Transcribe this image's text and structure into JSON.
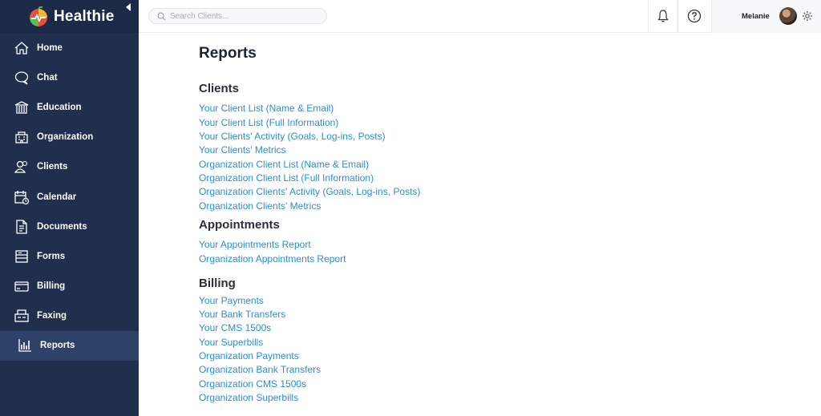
{
  "brand": {
    "name": "Healthie"
  },
  "sidebar": {
    "items": [
      {
        "label": "Home",
        "icon": "home-icon"
      },
      {
        "label": "Chat",
        "icon": "chat-icon"
      },
      {
        "label": "Education",
        "icon": "education-icon"
      },
      {
        "label": "Organization",
        "icon": "organization-icon"
      },
      {
        "label": "Clients",
        "icon": "clients-icon"
      },
      {
        "label": "Calendar",
        "icon": "calendar-icon"
      },
      {
        "label": "Documents",
        "icon": "documents-icon"
      },
      {
        "label": "Forms",
        "icon": "forms-icon"
      },
      {
        "label": "Billing",
        "icon": "billing-icon"
      },
      {
        "label": "Faxing",
        "icon": "faxing-icon"
      },
      {
        "label": "Reports",
        "icon": "reports-icon",
        "active": true
      }
    ]
  },
  "search": {
    "placeholder": "Search Clients..."
  },
  "user": {
    "name": "Melanie"
  },
  "page": {
    "title": "Reports"
  },
  "sections": {
    "clients": {
      "title": "Clients",
      "links": [
        "Your Client List (Name & Email)",
        "Your Client List (Full Information)",
        "Your Clients' Activity (Goals, Log-ins, Posts)",
        "Your Clients' Metrics",
        "Organization Client List (Name & Email)",
        "Organization Client List (Full Information)",
        "Organization Clients' Activity (Goals, Log-ins, Posts)",
        "Organization Clients' Metrics"
      ]
    },
    "appointments": {
      "title": "Appointments",
      "links": [
        "Your Appointments Report",
        "Organization Appointments Report"
      ]
    },
    "billing": {
      "title": "Billing",
      "links": [
        "Your Payments",
        "Your Bank Transfers",
        "Your CMS 1500s",
        "Your Superbills",
        "Organization Payments",
        "Organization Bank Transfers",
        "Organization CMS 1500s",
        "Organization Superbills"
      ]
    }
  },
  "colors": {
    "sidebar": "#1f2f4d",
    "sidebar_active": "#2e4169",
    "link": "#2c8ed6"
  }
}
